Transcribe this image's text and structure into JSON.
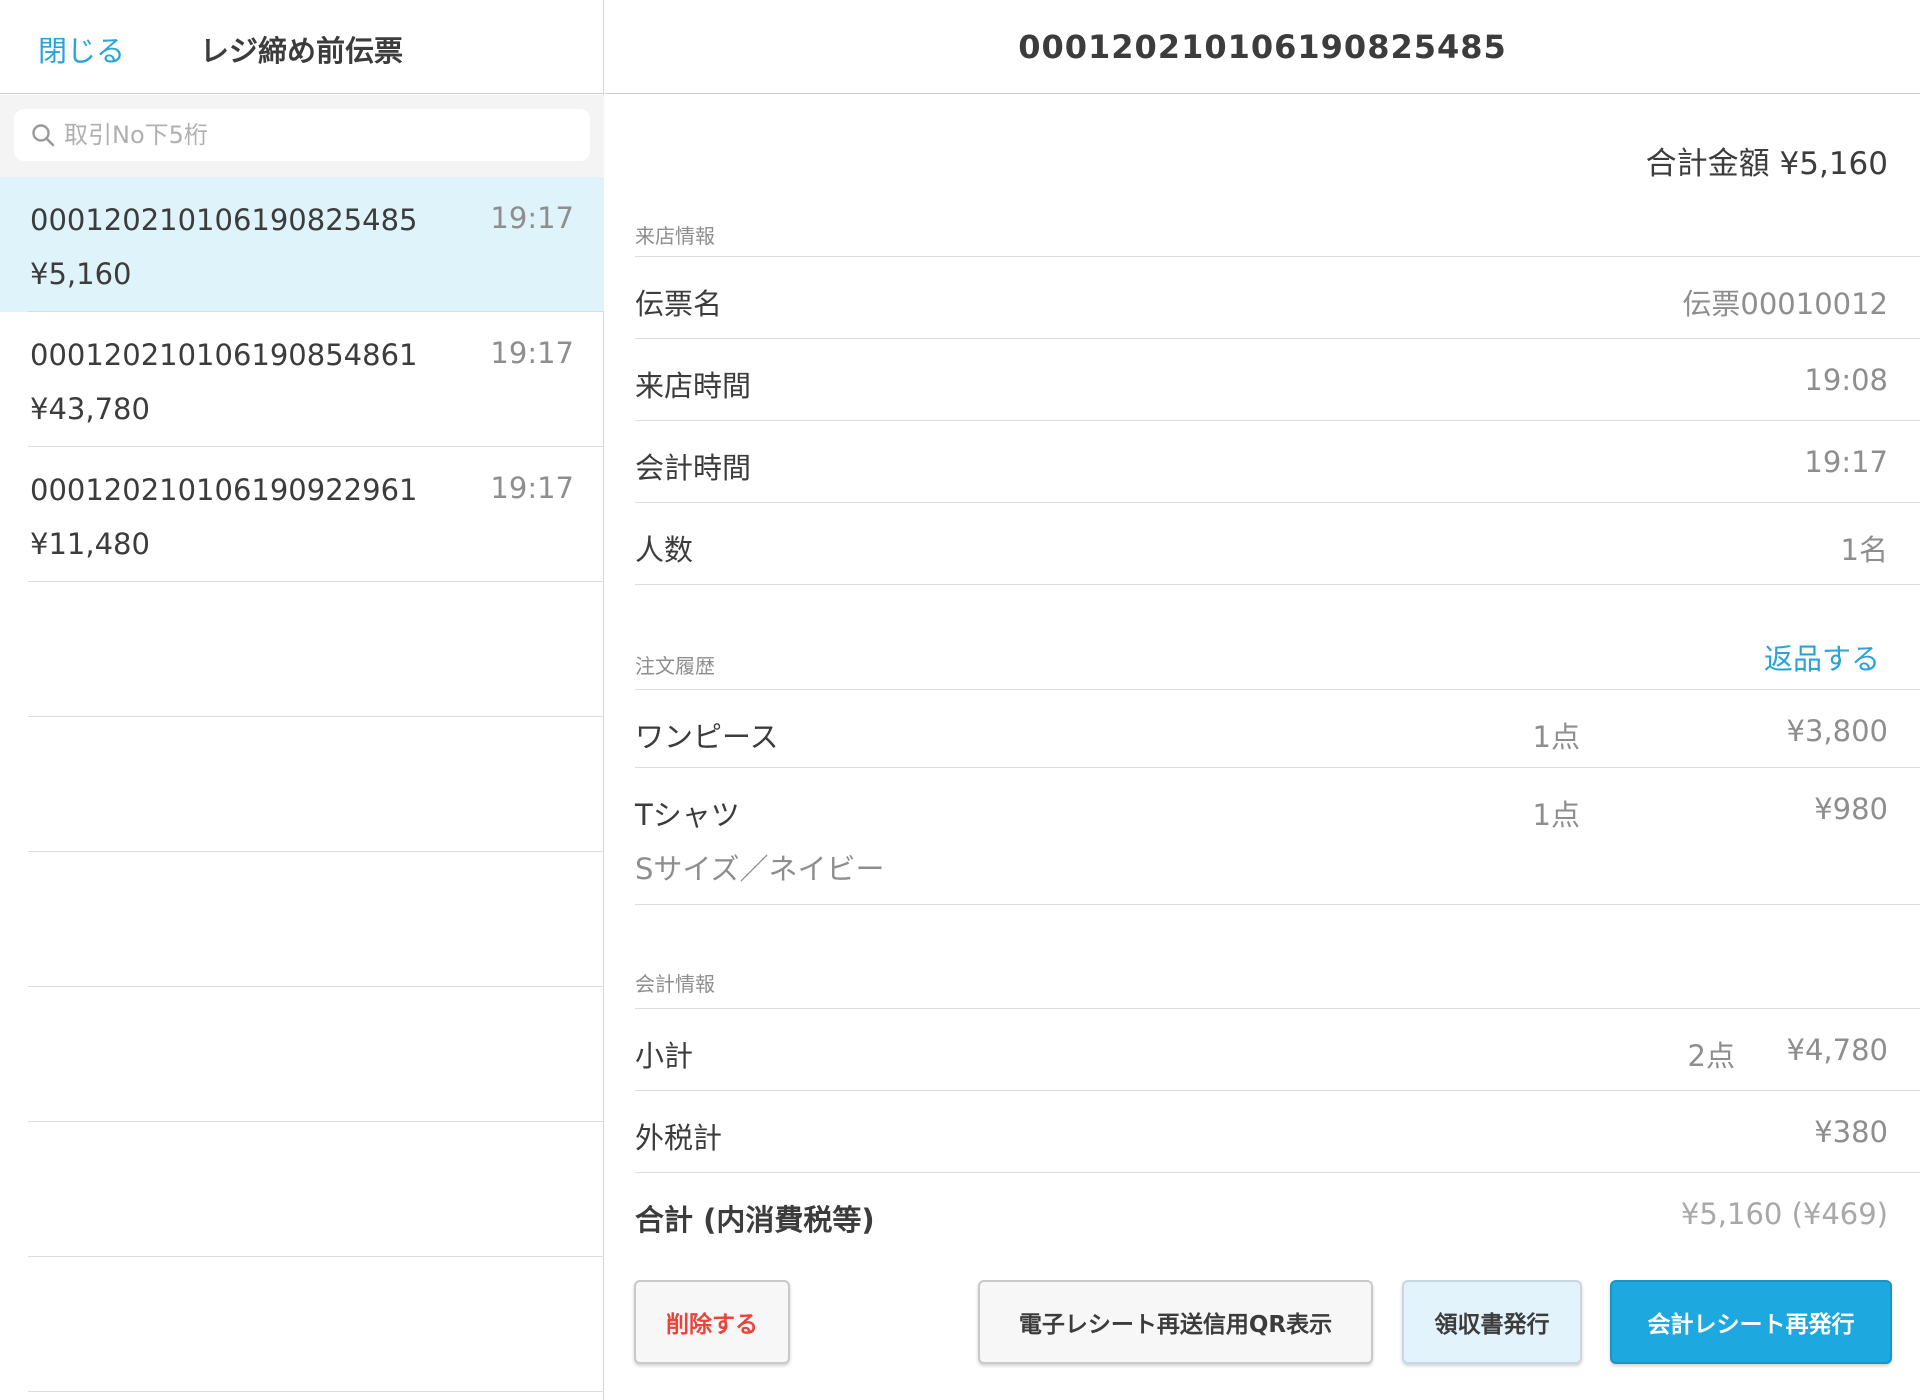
{
  "left_header": {
    "close_label": "閉じる",
    "title": "レジ締め前伝票"
  },
  "search": {
    "placeholder": "取引No下5桁",
    "icon": "search-icon"
  },
  "transactions": [
    {
      "no": "00012021010619082548​5",
      "amount": "¥5,160",
      "time": "19:17",
      "selected": true
    },
    {
      "no": "00012021010619085486​1",
      "amount": "¥43,780",
      "time": "19:17",
      "selected": false
    },
    {
      "no": "00012021010619092296​1",
      "amount": "¥11,480",
      "time": "19:17",
      "selected": false
    }
  ],
  "detail": {
    "title": "000120210106190825485",
    "total_top": "合計金額 ¥5,160",
    "visit_section": {
      "label": "来店情報",
      "rows": [
        {
          "label": "伝票名",
          "value": "伝票00010012"
        },
        {
          "label": "来店時間",
          "value": "19:08"
        },
        {
          "label": "会計時間",
          "value": "19:17"
        },
        {
          "label": "人数",
          "value": "1名"
        }
      ]
    },
    "order_section": {
      "label": "注文履歴",
      "return_label": "返品する",
      "items": [
        {
          "name": "ワンピース",
          "qty": "1点",
          "price": "¥3,800",
          "variant": ""
        },
        {
          "name": "Tシャツ",
          "qty": "1点",
          "price": "¥980",
          "variant": "Sサイズ／ネイビー"
        }
      ]
    },
    "payment_section": {
      "label": "会計情報",
      "subtotal": {
        "label": "小計",
        "qty": "2点",
        "value": "¥4,780"
      },
      "tax": {
        "label": "外税計",
        "value": "¥380"
      },
      "total": {
        "label": "合計 (内消費税等)",
        "value": "¥5,160 (¥469)"
      }
    }
  },
  "buttons": {
    "delete": "削除する",
    "qr": "電子レシート再送信用QR表示",
    "receipt": "領収書発行",
    "reissue": "会計レシート再発行"
  },
  "colors": {
    "accent": "#2aa3d8",
    "selected_bg": "#dff3fb",
    "danger": "#e8453c",
    "primary_button": "#1ea8e0"
  }
}
